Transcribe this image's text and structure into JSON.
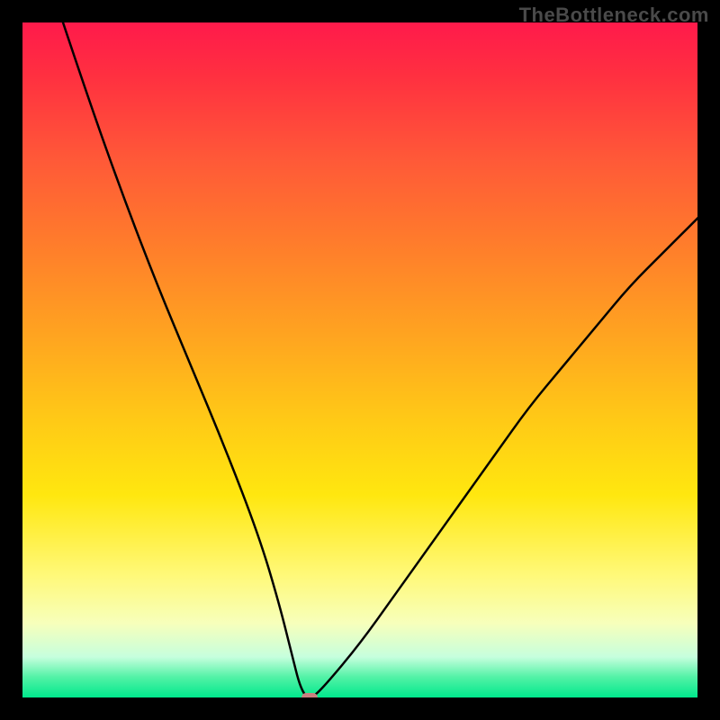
{
  "watermark": "TheBottleneck.com",
  "chart_data": {
    "type": "line",
    "title": "",
    "xlabel": "",
    "ylabel": "",
    "xlim": [
      0,
      100
    ],
    "ylim": [
      0,
      100
    ],
    "grid": false,
    "legend": false,
    "series": [
      {
        "name": "bottleneck-curve",
        "x": [
          6,
          10,
          15,
          20,
          25,
          30,
          35,
          38,
          40,
          41,
          42,
          43,
          45,
          50,
          55,
          60,
          65,
          70,
          75,
          80,
          85,
          90,
          95,
          100
        ],
        "values": [
          100,
          88,
          74,
          61,
          49,
          37,
          24,
          14,
          6,
          2,
          0,
          0,
          2,
          8,
          15,
          22,
          29,
          36,
          43,
          49,
          55,
          61,
          66,
          71
        ]
      }
    ],
    "minimum_marker": {
      "x": 42.5,
      "y": 0,
      "color": "#c98080"
    },
    "background_gradient": {
      "direction": "vertical",
      "stops": [
        {
          "pos": 0,
          "color": "#ff1a4b"
        },
        {
          "pos": 0.5,
          "color": "#ffc717"
        },
        {
          "pos": 0.9,
          "color": "#f7ffbb"
        },
        {
          "pos": 1.0,
          "color": "#00e88c"
        }
      ]
    }
  }
}
